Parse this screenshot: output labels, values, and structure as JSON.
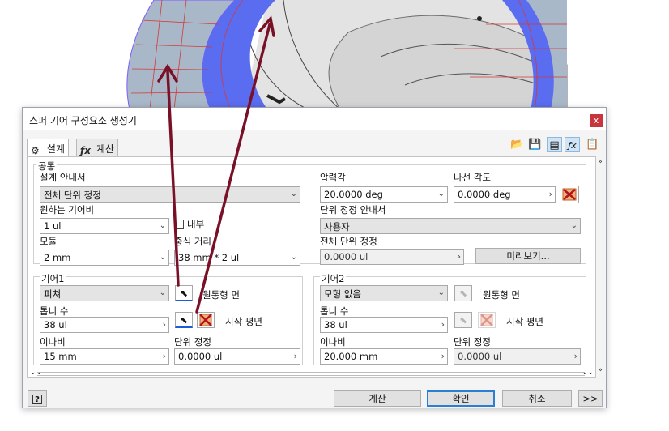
{
  "dialog": {
    "title": "스퍼 기어 구성요소 생성기",
    "close_glyph": "x",
    "tabs": [
      {
        "label": "설계",
        "icon": "gear-design-icon"
      },
      {
        "label": "계산",
        "icon": "fx-icon"
      }
    ],
    "toolbar_icons": [
      "open-folder-icon",
      "save-icon",
      "options-icon",
      "fx-icon",
      "notes-icon"
    ]
  },
  "common": {
    "group_label": "공통",
    "design_guide_label": "설계 안내서",
    "design_guide_value": "전체 단위 정정",
    "pressure_angle_label": "압력각",
    "pressure_angle_value": "20.0000 deg",
    "helix_angle_label": "나선 각도",
    "helix_angle_value": "0.0000 deg",
    "desired_ratio_label": "원하는 기어비",
    "desired_ratio_value": "1 ul",
    "internal_label": "내부",
    "unit_correction_guide_label": "단위 정정 안내서",
    "unit_correction_guide_value": "사용자",
    "module_label": "모듈",
    "module_value": "2 mm",
    "center_distance_label": "중심 거리",
    "center_distance_value": "38 mm * 2 ul",
    "total_correction_label": "전체 단위 정정",
    "total_correction_value": "0.0000 ul",
    "preview_button": "미리보기..."
  },
  "gear1": {
    "group_label": "기어1",
    "type_value": "피쳐",
    "cylindrical_face_label": "원통형 면",
    "start_plane_label": "시작 평면",
    "teeth_label": "톱니 수",
    "teeth_value": "38 ul",
    "face_width_label": "이나비",
    "face_width_value": "15 mm",
    "unit_correction_label": "단위 정정",
    "unit_correction_value": "0.0000 ul"
  },
  "gear2": {
    "group_label": "기어2",
    "type_value": "모형 없음",
    "cylindrical_face_label": "원통형 면",
    "start_plane_label": "시작 평면",
    "teeth_label": "톱니 수",
    "teeth_value": "38 ul",
    "face_width_label": "이나비",
    "face_width_value": "20.000 mm",
    "unit_correction_label": "단위 정정",
    "unit_correction_value": "0.0000 ul"
  },
  "footer": {
    "help_glyph": "?",
    "calculate": "계산",
    "ok": "확인",
    "cancel": "취소",
    "more": ">>"
  },
  "colors": {
    "annotation_arrow": "#7a1027",
    "gear_blue": "#5a6cf0",
    "gear_grey": "#a9b8c8",
    "selection_underline": "#1f5bd8",
    "default_button_border": "#2a7fd4"
  }
}
